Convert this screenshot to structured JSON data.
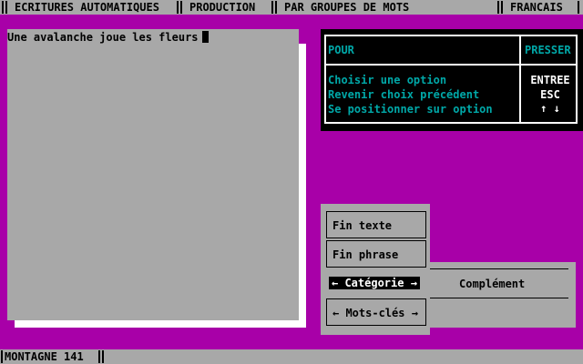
{
  "menu": {
    "items": [
      {
        "label": "ECRITURES AUTOMATIQUES"
      },
      {
        "label": "PRODUCTION"
      },
      {
        "label": "PAR GROUPES DE MOTS"
      },
      {
        "label": "FRANCAIS"
      }
    ]
  },
  "editor": {
    "text": "Une avalanche joue les fleurs"
  },
  "help": {
    "col_action": "POUR",
    "col_key": "PRESSER",
    "rows": [
      {
        "action": "Choisir une option",
        "key": "ENTREE"
      },
      {
        "action": "Revenir choix précédent",
        "key": "ESC"
      },
      {
        "action": "Se positionner sur option",
        "key": "↑  ↓"
      }
    ]
  },
  "commands": {
    "items": [
      {
        "label": "Fin texte"
      },
      {
        "label": "Fin phrase"
      },
      {
        "label": "← Catégorie →",
        "selected": true
      },
      {
        "label": "← Mots-clés →"
      }
    ],
    "submenu": {
      "label": "Complément"
    }
  },
  "status": {
    "text": "MONTAGNE 141"
  },
  "colors": {
    "background": "#a800a8",
    "panel": "#a8a8a8",
    "help_text": "#00a8a8"
  }
}
